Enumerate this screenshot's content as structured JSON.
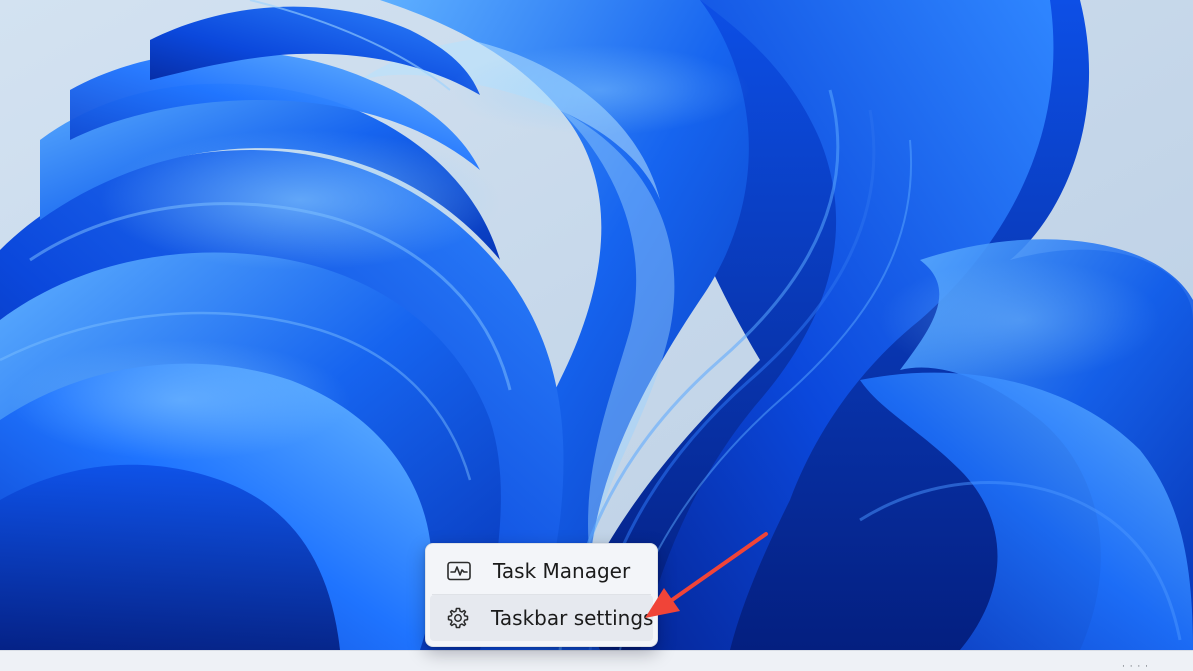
{
  "context_menu": {
    "items": [
      {
        "label": "Task Manager",
        "icon": "task-manager-icon"
      },
      {
        "label": "Taskbar settings",
        "icon": "gear-icon"
      }
    ]
  },
  "colors": {
    "wallpaper_base": "#0a44d6",
    "wallpaper_highlight": "#3c8cff",
    "wallpaper_deep": "#062a9c",
    "menu_background": "#f3f5f9",
    "annotation_arrow": "#f04438"
  }
}
